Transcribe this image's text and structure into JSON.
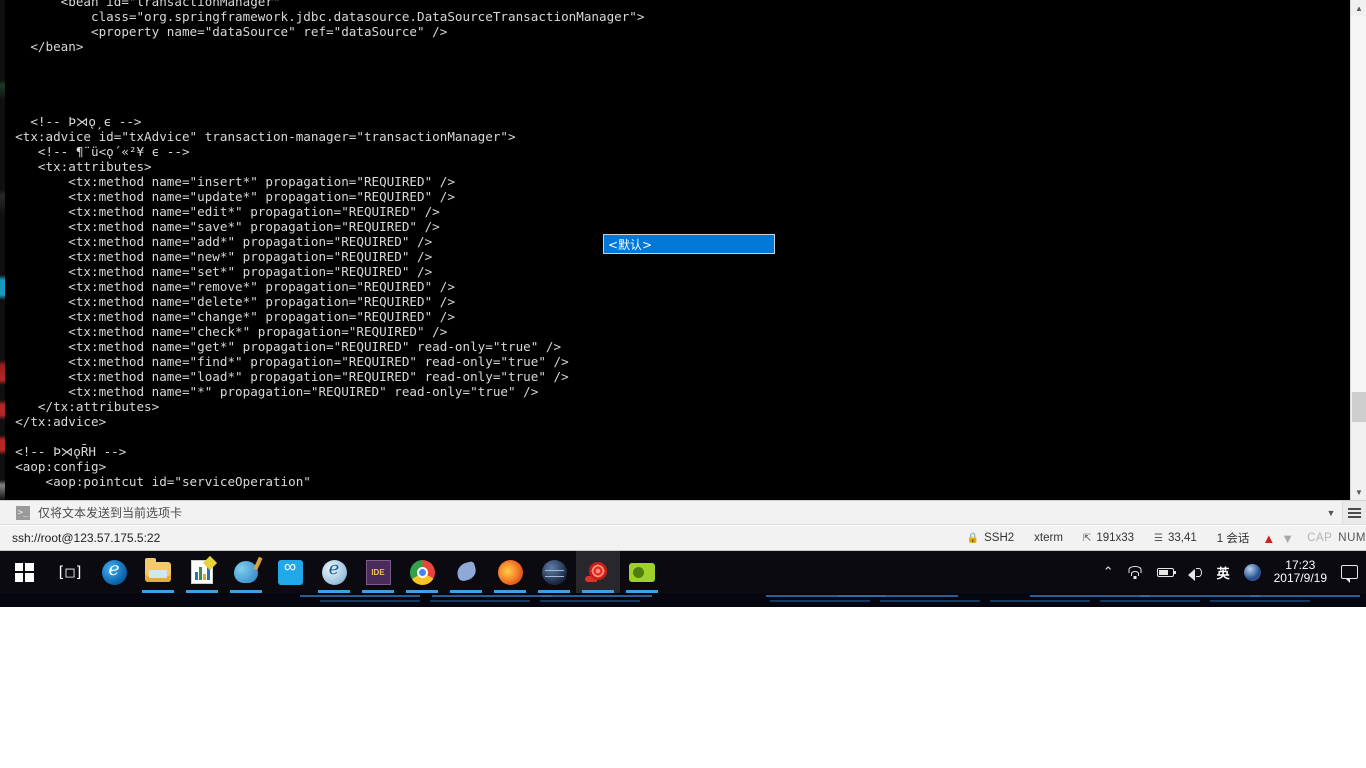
{
  "terminal": {
    "prompt_host": "ssh://root@123.57.175.5:22",
    "content": "        <bean id=\"transactionManager\"\n            class=\"org.springframework.jdbc.datasource.DataSourceTransactionManager\">\n            <property name=\"dataSource\" ref=\"dataSource\" />\n    </bean>\n\n\n\n\n    <!-- Þ⋊ǫ̦ ϵ -->\n  <tx:advice id=\"txAdvice\" transaction-manager=\"transactionManager\">\n     <!-- ¶¨ü<ǫ´«²¥ ϵ -->\n     <tx:attributes>\n         <tx:method name=\"insert*\" propagation=\"REQUIRED\" />\n         <tx:method name=\"update*\" propagation=\"REQUIRED\" />\n         <tx:method name=\"edit*\" propagation=\"REQUIRED\" />\n         <tx:method name=\"save*\" propagation=\"REQUIRED\" />\n         <tx:method name=\"add*\" propagation=\"REQUIRED\" />\n         <tx:method name=\"new*\" propagation=\"REQUIRED\" />\n         <tx:method name=\"set*\" propagation=\"REQUIRED\" />\n         <tx:method name=\"remove*\" propagation=\"REQUIRED\" />\n         <tx:method name=\"delete*\" propagation=\"REQUIRED\" />\n         <tx:method name=\"change*\" propagation=\"REQUIRED\" />\n         <tx:method name=\"check*\" propagation=\"REQUIRED\" />\n         <tx:method name=\"get*\" propagation=\"REQUIRED\" read-only=\"true\" />\n         <tx:method name=\"find*\" propagation=\"REQUIRED\" read-only=\"true\" />\n         <tx:method name=\"load*\" propagation=\"REQUIRED\" read-only=\"true\" />\n         <tx:method name=\"*\" propagation=\"REQUIRED\" read-only=\"true\" />\n     </tx:attributes>\n  </tx:advice>\n\n  <!-- Þ⋊ǫR̄H -->\n  <aop:config>\n      <aop:pointcut id=\"serviceOperation\""
  },
  "popup": {
    "label": "<默认>",
    "bg_color": "#0078d7",
    "text_color": "#ffffff"
  },
  "command_bar": {
    "icon": "console-icon",
    "label": "仅将文本发送到当前选项卡",
    "chevron": "▼",
    "menu_icon": "hamburger-icon"
  },
  "status_bar": {
    "connection": "ssh://root@123.57.175.5:22",
    "protocol": "SSH2",
    "terminal_type": "xterm",
    "size": "191x33",
    "cursor": "33,41",
    "sessions": "1 会话",
    "caps": "CAP",
    "num": "NUM",
    "lock_icon": "lock-icon",
    "resize_icon": "resize-icon",
    "cursor_icon": "cursor-icon",
    "arrow_up": "▲",
    "arrow_down": "▼"
  },
  "taskbar": {
    "start": "start-button",
    "task_view": "task-view-button",
    "items": [
      {
        "name": "edge",
        "icon": "edge-icon",
        "running": true,
        "active": false
      },
      {
        "name": "file-explorer",
        "icon": "folder-icon",
        "running": true,
        "active": false
      },
      {
        "name": "chart-app",
        "icon": "chart-icon",
        "running": true,
        "active": false
      },
      {
        "name": "paint",
        "icon": "paint-icon",
        "running": true,
        "active": false
      },
      {
        "name": "cloud-app",
        "icon": "cloud-icon",
        "running": false,
        "active": false
      },
      {
        "name": "internet-explorer",
        "icon": "ie-icon",
        "running": true,
        "active": false
      },
      {
        "name": "ide-app",
        "icon": "ide-icon",
        "running": true,
        "active": false
      },
      {
        "name": "chrome",
        "icon": "chrome-icon",
        "running": true,
        "active": false
      },
      {
        "name": "navicat",
        "icon": "dolphin-icon",
        "running": true,
        "active": false
      },
      {
        "name": "firefox",
        "icon": "firefox-icon",
        "running": true,
        "active": false
      },
      {
        "name": "globe-app",
        "icon": "globe-icon",
        "running": true,
        "active": false
      },
      {
        "name": "xshell",
        "icon": "snail-icon",
        "running": true,
        "active": true
      },
      {
        "name": "camera-app",
        "icon": "camera-icon",
        "running": true,
        "active": false
      }
    ]
  },
  "tray": {
    "overflow": "⌃",
    "wifi": "wifi-icon",
    "battery": "battery-icon",
    "volume": "volume-icon",
    "ime": "英",
    "app": "tray-app-icon",
    "time": "17:23",
    "date": "2017/9/19",
    "notification": "notification-icon"
  },
  "scrollbar": {
    "up": "▲",
    "down": "▼"
  }
}
